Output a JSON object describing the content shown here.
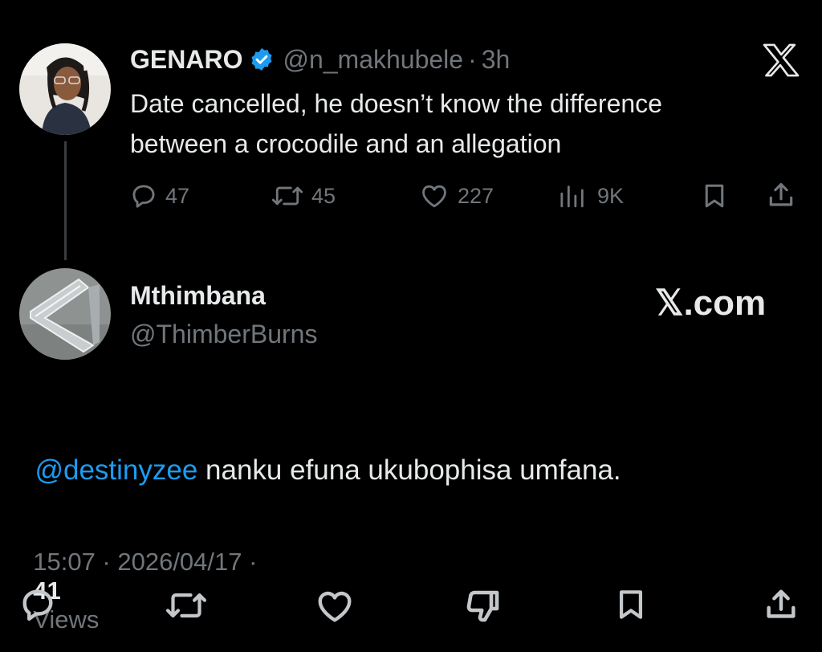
{
  "quoted_tweet": {
    "author_name": "GENARO",
    "handle": "@n_makhubele",
    "separator": "·",
    "time": "3h",
    "text_line1": "Date cancelled, he doesn’t know the difference",
    "text_line2": "between a crocodile and an allegation",
    "stats": {
      "replies": "47",
      "reposts": "45",
      "likes": "227",
      "views": "9K"
    },
    "verified": true,
    "x_logo_icon": "x-logo-icon"
  },
  "reply_tweet": {
    "author_name": "Mthimbana",
    "handle": "@ThimberBurns",
    "watermark": "𝕏.com",
    "mention": "@destinyzee",
    "text": " nanku efuna ukubophisa umfana.",
    "timestamp": "15:07 · 2026/04/17 ·",
    "views_count": "41",
    "views_label": "Views"
  },
  "colors": {
    "background": "#000000",
    "text": "#e7e9ea",
    "muted": "#71767b",
    "accent": "#1d9bf0"
  },
  "icons": [
    "reply-icon",
    "repost-icon",
    "like-icon",
    "views-icon",
    "bookmark-icon",
    "share-icon",
    "dislike-icon",
    "verified-badge-icon"
  ]
}
